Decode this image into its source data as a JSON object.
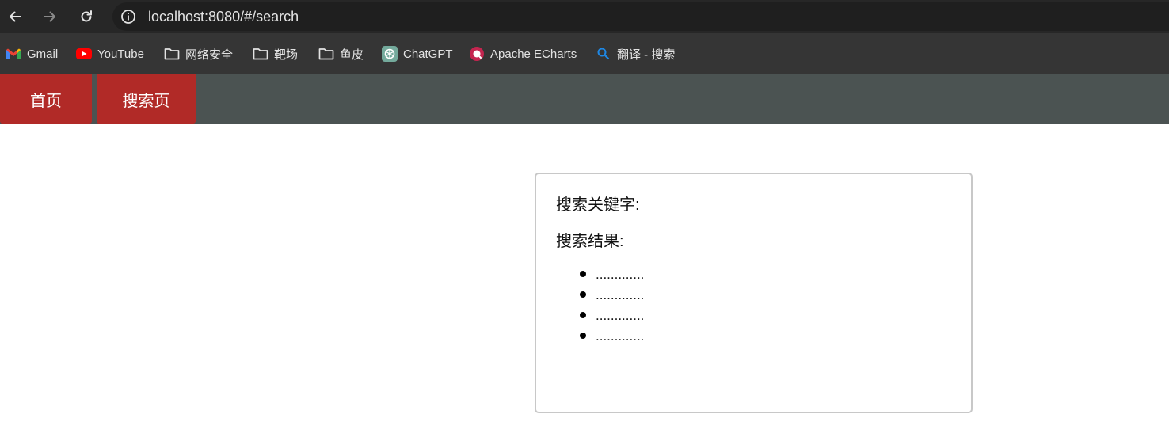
{
  "browser": {
    "url": "localhost:8080/#/search",
    "bookmarks": [
      {
        "label": "Gmail",
        "icon": "gmail-icon"
      },
      {
        "label": "YouTube",
        "icon": "youtube-icon"
      },
      {
        "label": "网络安全",
        "icon": "folder-icon"
      },
      {
        "label": "靶场",
        "icon": "folder-icon"
      },
      {
        "label": "鱼皮",
        "icon": "folder-icon"
      },
      {
        "label": "ChatGPT",
        "icon": "chatgpt-icon"
      },
      {
        "label": "Apache ECharts",
        "icon": "echarts-icon"
      },
      {
        "label": "翻译 - 搜索",
        "icon": "search-icon"
      }
    ]
  },
  "app": {
    "nav": [
      {
        "label": "首页"
      },
      {
        "label": "搜索页"
      }
    ],
    "search": {
      "keyword_label": "搜索关键字:",
      "results_label": "搜索结果:",
      "results": [
        ".............",
        ".............",
        ".............",
        "............."
      ]
    }
  },
  "colors": {
    "tab_bg": "#b12a27",
    "nav_bg": "#4b5352",
    "browser_bar": "#272727",
    "bookmarks_bar": "#353535"
  }
}
